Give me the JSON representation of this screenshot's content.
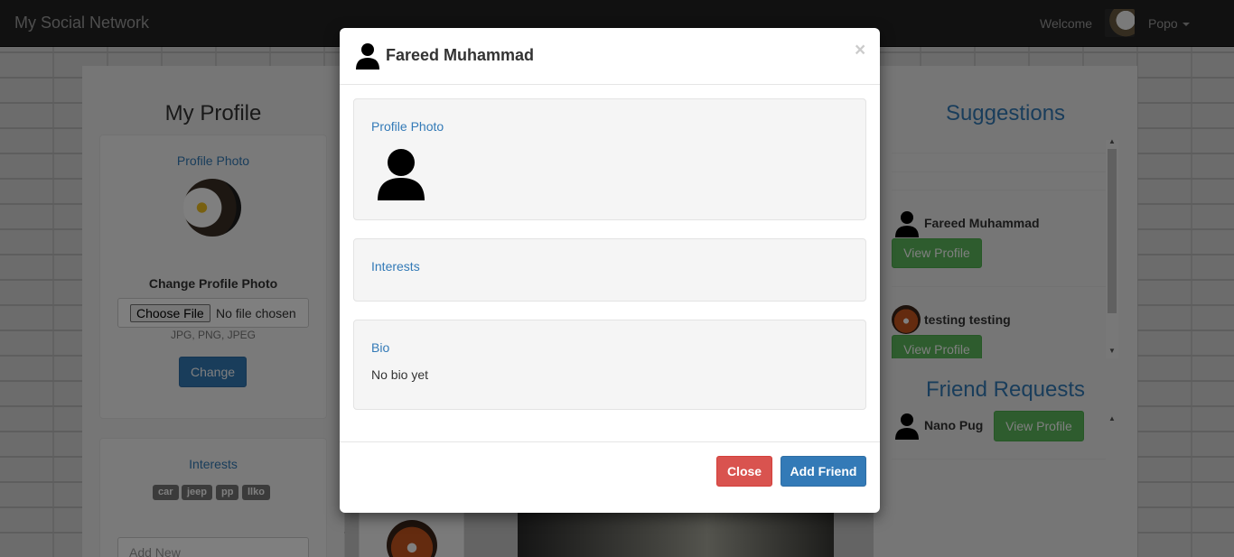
{
  "navbar": {
    "brand": "My Social Network",
    "welcome": "Welcome",
    "user_name": "Popo"
  },
  "left": {
    "title": "My Profile",
    "profile_photo_label": "Profile Photo",
    "change_photo_title": "Change Profile Photo",
    "choose_file_label": "Choose File",
    "no_file_label": "No file chosen",
    "file_types": "JPG, PNG, JPEG",
    "change_button": "Change",
    "interests_label": "Interests",
    "interest_tags": [
      "car",
      "jeep",
      "pp",
      "llko"
    ],
    "add_new_placeholder": "Add New"
  },
  "right": {
    "suggestions_title": "Suggestions",
    "suggestions": [
      {
        "name": "Fareed Muhammad",
        "button": "View Profile"
      },
      {
        "name": "testing testing",
        "button": "View Profile"
      }
    ],
    "friend_requests_title": "Friend Requests",
    "friend_requests": [
      {
        "name": "Nano Pug",
        "button": "View Profile"
      }
    ]
  },
  "modal": {
    "title": "Fareed Muhammad",
    "close_x": "×",
    "profile_photo_label": "Profile Photo",
    "interests_label": "Interests",
    "bio_label": "Bio",
    "bio_text": "No bio yet",
    "close_button": "Close",
    "add_friend_button": "Add Friend"
  }
}
